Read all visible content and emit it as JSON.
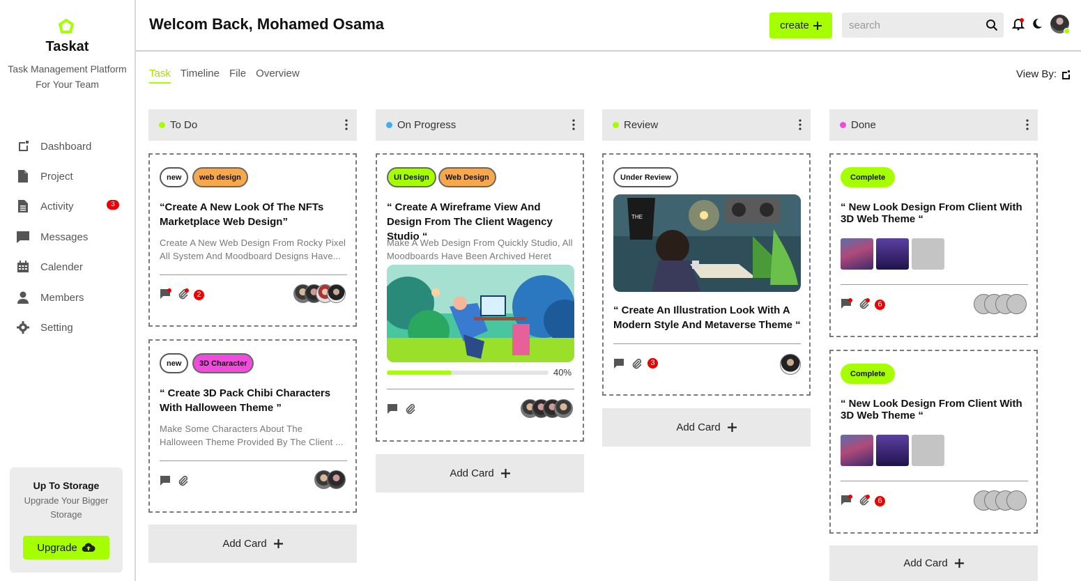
{
  "app": {
    "name": "Taskat",
    "tagline": "Task Management Platform For Your Team",
    "accent": "#a6ff00"
  },
  "sidebar": {
    "items": [
      {
        "label": "Dashboard",
        "icon": "dashboard-icon"
      },
      {
        "label": "Project",
        "icon": "document-icon"
      },
      {
        "label": "Activity",
        "icon": "activity-icon",
        "badge": "3"
      },
      {
        "label": "Messages",
        "icon": "chat-icon"
      },
      {
        "label": "Calender",
        "icon": "calendar-icon"
      },
      {
        "label": "Members",
        "icon": "user-icon"
      },
      {
        "label": "Setting",
        "icon": "gear-icon"
      }
    ],
    "storage": {
      "title": "Up To Storage",
      "subtitle": "Upgrade Your Bigger Storage",
      "button": "Upgrade"
    }
  },
  "header": {
    "welcome": "Welcom Back, Mohamed Osama",
    "create_label": "create",
    "search_placeholder": "search"
  },
  "tabs": [
    {
      "label": "Task",
      "active": true
    },
    {
      "label": "Timeline"
    },
    {
      "label": "File"
    },
    {
      "label": "Overview"
    }
  ],
  "view_by": "View By:",
  "columns": [
    {
      "title": "To Do",
      "color": "#a6ff00"
    },
    {
      "title": "On Progress",
      "color": "#3bb0f0"
    },
    {
      "title": "Review",
      "color": "#a6ff00"
    },
    {
      "title": "Done",
      "color": "#f04bdc"
    }
  ],
  "cards": {
    "todo1": {
      "tags": [
        "new",
        "web design"
      ],
      "title": "“Create A New Look Of The NFTs Marketplace Web Design”",
      "desc": "Create A New Web Design From Rocky Pixel All System And Moodboard Designs Have...",
      "count": "2"
    },
    "todo2": {
      "tags": [
        "new",
        "3D Character"
      ],
      "title": "“ Create 3D Pack Chibi Characters With Halloween Theme ”",
      "desc": "Make Some Characters About The Halloween Theme Provided By The Client ..."
    },
    "progress1": {
      "tags": [
        "UI Design",
        "Web Design"
      ],
      "title": "“ Create A Wireframe View And Design From The Client Wagency Studio “",
      "desc": "Make A Web Design From Quickly Studio, All Moodboards Have Been Archived Heret",
      "progress": 40,
      "progress_label": "40%"
    },
    "review1": {
      "tags": [
        "Under Review"
      ],
      "title": "“ Create An Illustration Look With A Modern Style And Metaverse Theme “",
      "count": "3"
    },
    "done1": {
      "tags": [
        "Complete"
      ],
      "title": "“ New Look Design From Client With 3D Web Theme “",
      "count": "6"
    },
    "done2": {
      "tags": [
        "Complete"
      ],
      "title": "“ New Look Design From Client With 3D Web Theme “",
      "count": "6"
    }
  },
  "add_card_label": "Add Card"
}
